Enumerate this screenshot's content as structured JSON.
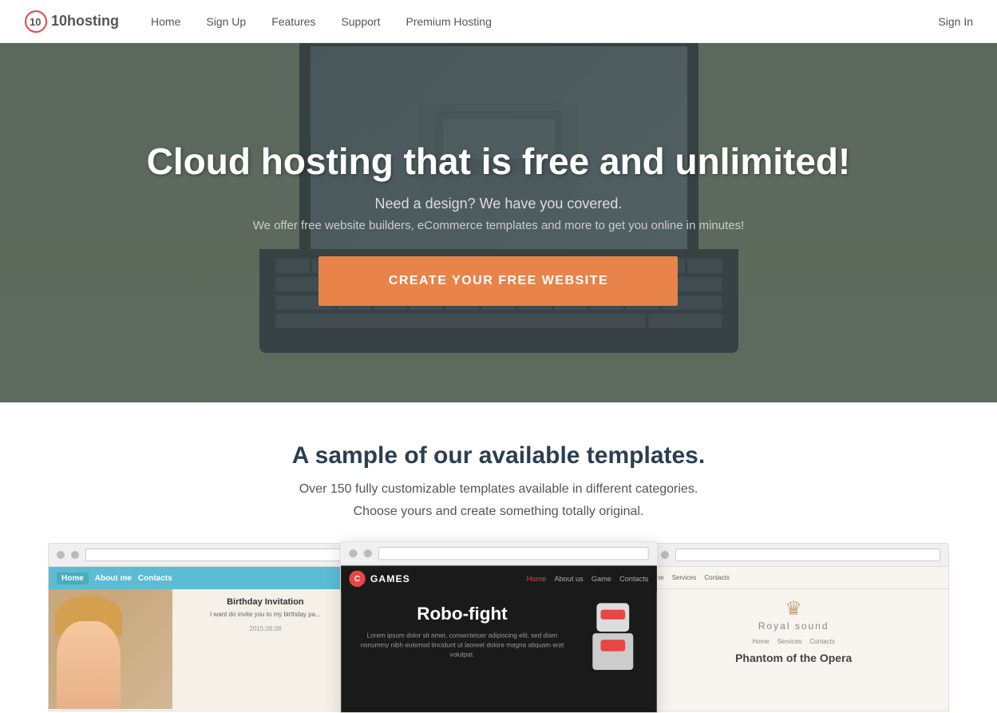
{
  "navbar": {
    "logo_text": "10hosting",
    "links": [
      {
        "label": "Home",
        "id": "home"
      },
      {
        "label": "Sign Up",
        "id": "signup"
      },
      {
        "label": "Features",
        "id": "features"
      },
      {
        "label": "Support",
        "id": "support"
      },
      {
        "label": "Premium Hosting",
        "id": "premium"
      }
    ],
    "signin_label": "Sign In"
  },
  "hero": {
    "title": "Cloud hosting that is free and unlimited!",
    "subtitle": "Need a design? We have you covered.",
    "description": "We offer free website builders, eCommerce templates and more to get you online in minutes!",
    "cta_label": "CREATE YOUR FREE WEBSITE"
  },
  "templates_section": {
    "title": "A sample of our available templates.",
    "subtitle": "Over 150 fully customizable templates available in different categories.",
    "subtitle2": "Choose yours and create something totally original."
  },
  "template_previews": [
    {
      "id": "birthday",
      "nav_items": [
        "Home",
        "About me",
        "Contacts"
      ],
      "heading": "Birthday Invitation",
      "body": "I want do invite you to my birthday pa...",
      "date": "2015.08.08"
    },
    {
      "id": "games",
      "logo_letter": "C",
      "logo_name": "GAMES",
      "nav_items": [
        "Home",
        "About us",
        "Game",
        "Contacts"
      ],
      "title": "Robo-fight",
      "body": "Lorem ipsum dolor sit amet, consectetuer adipiscing elit, sed diam nonummy nibh euismod tincidunt ut laoreet dolore magna aliquam erat volutpat."
    },
    {
      "id": "royal",
      "logo_text": "Royal sound",
      "nav_items": [
        "Home",
        "Services",
        "Contacts"
      ],
      "title": "Phantom of the Opera",
      "subtitle": ""
    }
  ],
  "colors": {
    "hero_bg": "#6b7c6b",
    "cta_bg": "#e8834a",
    "brand_red": "#e84545",
    "dark_bg": "#1a1a1a",
    "light_bg": "#f8f4f0"
  }
}
